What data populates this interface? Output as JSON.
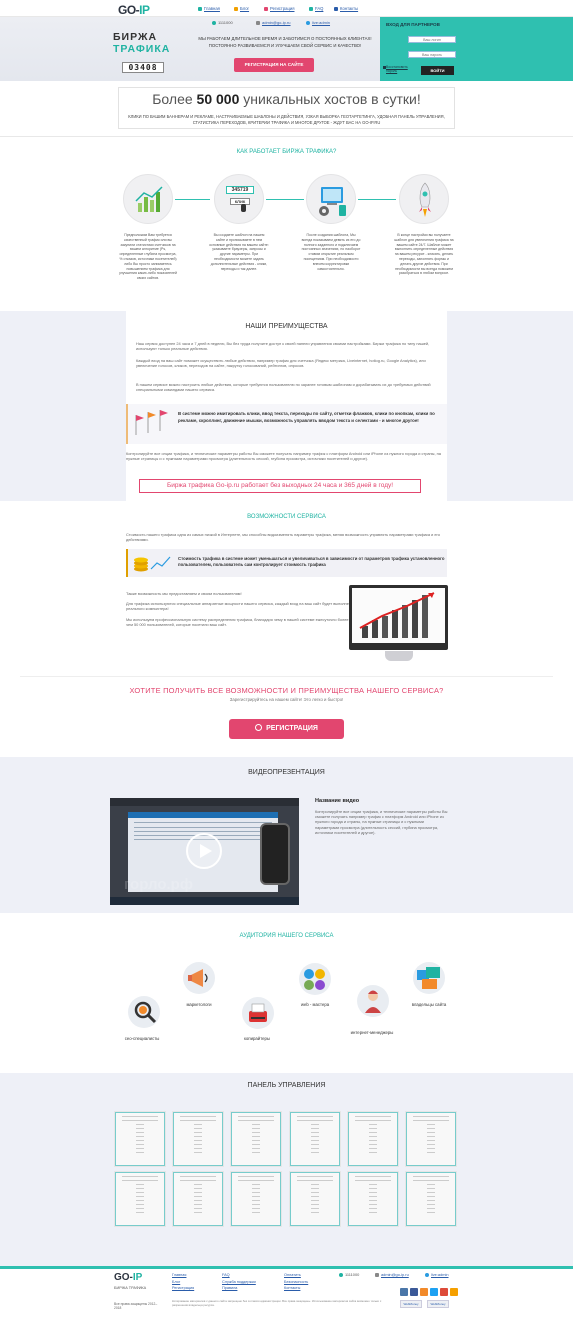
{
  "nav": {
    "logo_main": "GO-",
    "logo_accent": "IP",
    "links": [
      "Главная",
      "Блог",
      "Регистрация",
      "FAQ",
      "Контакты"
    ]
  },
  "header": {
    "phone": "1111000",
    "email": "admin@go-ip.ru",
    "skype": "live:admin",
    "brand_line1": "БИРЖА",
    "brand_line2": "ТРАФИКА",
    "counter": "03408",
    "text": "МЫ РАБОТАЕМ ДЛИТЕЛЬНОЕ ВРЕМЯ И ЗАБОТИМСЯ О ПОСТОЯННЫХ КЛИЕНТАХ! ПОСТОЯННО РАЗВИВАЕМСЯ И УЛУЧШАЕМ СВОЙ СЕРВИС И КАЧЕСТВО!",
    "register_button": "РЕГИСТРАЦИЯ НА САЙТЕ"
  },
  "partner": {
    "title": "ВХОД ДЛЯ ПАРТНЕРОВ",
    "login_placeholder": "Ваш логин",
    "password_placeholder": "Ваш пароль",
    "forgot": "Восстановить пароль",
    "login_button": "ВОЙТИ"
  },
  "hosts": {
    "prefix": "Более",
    "number": "50 000",
    "middle": "уникальных",
    "suffix": "хостов в сутки!",
    "subtitle": "КЛИКИ ПО ВАШИМ БАННЕРАМ И РЕКЛАМЕ, НАСТРАИВАЕМЫЕ ШАБЛОНЫ И ДЕЙСТВИЯ, УЗКАЯ ВЫБОРКА ГЕОТАРГЕТИНГА, УДОБНАЯ ПАНЕЛЬ УПРАВЛЕНИЯ, СТАТИСТИКА ПЕРЕХОДОВ, КРИТЕРИИ ТРАФИКА И МНОГОЕ ДРУГОЕ - ЖДУТ ВАС НА GO-IP.RU"
  },
  "how": {
    "title": "КАК РАБОТАЕТ БИРЖА ТРАФИКА?",
    "counter_digits": "345719",
    "click_label": "КЛИК",
    "steps": [
      "Предположим Вам требуется качественный трафик или вы закупили статистики счетчиков на вашем алгоритме (Ps, определенные глубина просмотра, % отказов, источники посетителей) либо Вы просто занимаетесь повышением трафика для улучшения каких-либо показателей своих сайтов.",
      "Вы создаете шаблон на нашем сайте и прописываете в нем основные действия на вашем сайте: указываете браузеры, запросы и другие параметры. При необходимости можете задать дополнительные действия - клики, переходы и так далее.",
      "После создания шаблона, Мы всегда показываем девять из его до полного заданного и подключаем постоянных значениях, но наоборот ставим открытие реальным посещениям. При необходимости внесем корректировки самостоятельно.",
      "В конце настройки вы получаете шаблон для увеличения трафика на вашем сайте 24/7. Шаблон может выполнить определенные действия на вашем ресурсе - кликать, делать переходы, заполнять формы и делать другие действия. При необходимости вы всегда поможем разобраться в любом вопросе."
    ]
  },
  "advantages": {
    "title": "НАШИ ПРЕИМУЩЕСТВА",
    "p1": "Наш сервис доступен 24 часа и 7 дней в неделю, Вы без труда получите доступ к своей панели управления своими настройками. Биржи трафика по типу нашей, используют только реальные действия.",
    "p2": "Каждый вход на ваш сайт поможет осуществить любые действия, например трафик для счетчика (Яндекс метрика, Liveinternet, hotlog.ru, Google Analytics), или увеличение голосов, кликов, переходов на сайте, накрутку голосований, рейтингов, опросов.",
    "p3": "В нашем сервисе можно настроить любые действия, которые требуются пользователю по заранее готовым шаблонам и дорабатывать их до требуемых действий специальными командами нашего сервиса.",
    "flag_text": "В системе можно имитировать клики, ввод текста, переходы по сайту, отметки флажков, клики по кнопкам, клики по рекламе, скроллинг, движение мышки, возможность управлять вводом текста и селектами - и многое другое!",
    "p4": "Контролируйте все опции трафика, и технические параметры работы Вы сможете получать например трафик с платформ Android или iPhone из нужного города и страны, на нужные страницы и с нужными параметрами просмотра (длительность сессий, глубина просмотра, источники посетителей и другое).",
    "highlight": "Биржа трафика Go-ip.ru работает без выходных 24 часа и 365 дней в году!"
  },
  "features": {
    "title": "ВОЗМОЖНОСТИ СЕРВИСА",
    "p1": "Стоимость нашего трафика одна из самых низкой в Интернете, мы способны видоизменять параметры трафика, меняя возможность управлять параметрами трафика и его действиями.",
    "coin_text": "Стоимость трафика в системе может уменьшаться и увеличиваться в зависимости от параметров трафика установленного пользователем, пользователь сам контролирует стоимость трафика",
    "p2": "Также возможность мы предоставляем и своим пользователям!",
    "p3": "Для трафика используются специальные аппаратные мощности нашего сервиса, каждый вход на ваш сайт будет выполнен с реального компьютера!",
    "p4": "Мы используем профессиональную систему распределения трафика, благодаря чему в нашей системе ежесуточно более чем 50 000 пользователей, которые посетили ваш сайт."
  },
  "cta": {
    "title": "ХОТИТЕ ПОЛУЧИТЬ ВСЕ ВОЗМОЖНОСТИ И ПРЕИМУЩЕСТВА НАШЕГО СЕРВИСА?",
    "subtitle": "Зарегистрируйтесь на нашем сайте! Это легко и быстро!",
    "button": "РЕГИСТРАЦИЯ"
  },
  "video": {
    "title": "ВИДЕОПРЕЗЕНТАЦИЯ",
    "name": "Название видео",
    "description": "Контролируйте все опции трафика, и технические параметры работы Вы сможете получать например трафик с платформ Android или iPhone из нужного города и страны, на нужные страницы и с нужными параметрами просмотра (длительность сессий, глубина просмотра, источники посетителей и другое).",
    "watermark": "горло.рф"
  },
  "audience": {
    "title": "АУДИТОРИЯ НАШЕГО СЕРВИСА",
    "groups": [
      "сео-специалисты",
      "маркетологи",
      "копирайтеры",
      "web - мастера",
      "интернет-менеджеры",
      "владельцы сайта"
    ]
  },
  "panel": {
    "title": "ПАНЕЛЬ УПРАВЛЕНИЯ"
  },
  "footer": {
    "logo_main": "GO-",
    "logo_accent": "IP",
    "subtitle": "БИРЖА ТРАФИКА",
    "copyright": "Все права защищены 2012–2018",
    "col1": [
      "Главная",
      "Блог",
      "Регистрация"
    ],
    "col2": [
      "FAQ",
      "Служба поддержки",
      "Правила"
    ],
    "col3": [
      "Оплатить",
      "Безопасность",
      "Контакты"
    ],
    "note": "Копирование материалов с данного сайта запрещено без согласия администрации. Все права защищены. Использование материалов сайта возможно только с разрешения владельца ресурса.",
    "phone": "1111000",
    "email": "admin@go-ip.ru",
    "skype": "live:admin",
    "webmoney": [
      "WebMoney",
      "WebMoney"
    ]
  },
  "colors": {
    "accent": "#1fb3a2",
    "pink": "#e2466f",
    "panel_bg": "#eef0f7"
  }
}
